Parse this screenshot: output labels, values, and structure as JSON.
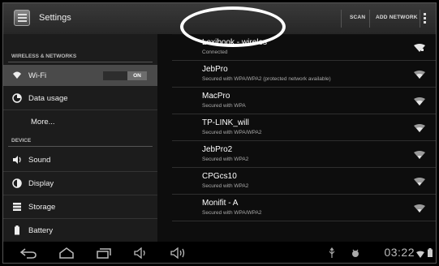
{
  "header": {
    "title": "Settings",
    "scan_label": "SCAN",
    "add_network_label": "ADD NETWORK"
  },
  "sidebar": {
    "sections": [
      {
        "label": "WIRELESS & NETWORKS"
      },
      {
        "label": "DEVICE"
      }
    ],
    "items": [
      {
        "label": "Wi-Fi",
        "icon": "wifi-icon",
        "toggle": "ON",
        "selected": true
      },
      {
        "label": "Data usage",
        "icon": "data-usage-icon"
      },
      {
        "label": "More..."
      },
      {
        "label": "Sound",
        "icon": "speaker-icon"
      },
      {
        "label": "Display",
        "icon": "display-icon"
      },
      {
        "label": "Storage",
        "icon": "storage-icon"
      },
      {
        "label": "Battery",
        "icon": "battery-icon"
      }
    ]
  },
  "networks": [
    {
      "name": "Lexibook - wireles",
      "status": "Connected"
    },
    {
      "name": "JebPro",
      "status": "Secured with WPA/WPA2 (protected network available)"
    },
    {
      "name": "MacPro",
      "status": "Secured with WPA"
    },
    {
      "name": "TP-LINK_will",
      "status": "Secured with WPA/WPA2"
    },
    {
      "name": "JebPro2",
      "status": "Secured with WPA2"
    },
    {
      "name": "CPGcs10",
      "status": "Secured with WPA2"
    },
    {
      "name": "Monifit - A",
      "status": "Secured with WPA/WPA2"
    }
  ],
  "navbar": {
    "icons": [
      "back-icon",
      "home-icon",
      "recent-apps-icon",
      "volume-down-icon",
      "volume-up-icon"
    ],
    "clock": "03:22"
  },
  "colors": {
    "background": "#0d0d0d",
    "sidebar": "#1c1c1c",
    "selected": "#4a4a4a",
    "highlight_oval": "#ffffff"
  }
}
